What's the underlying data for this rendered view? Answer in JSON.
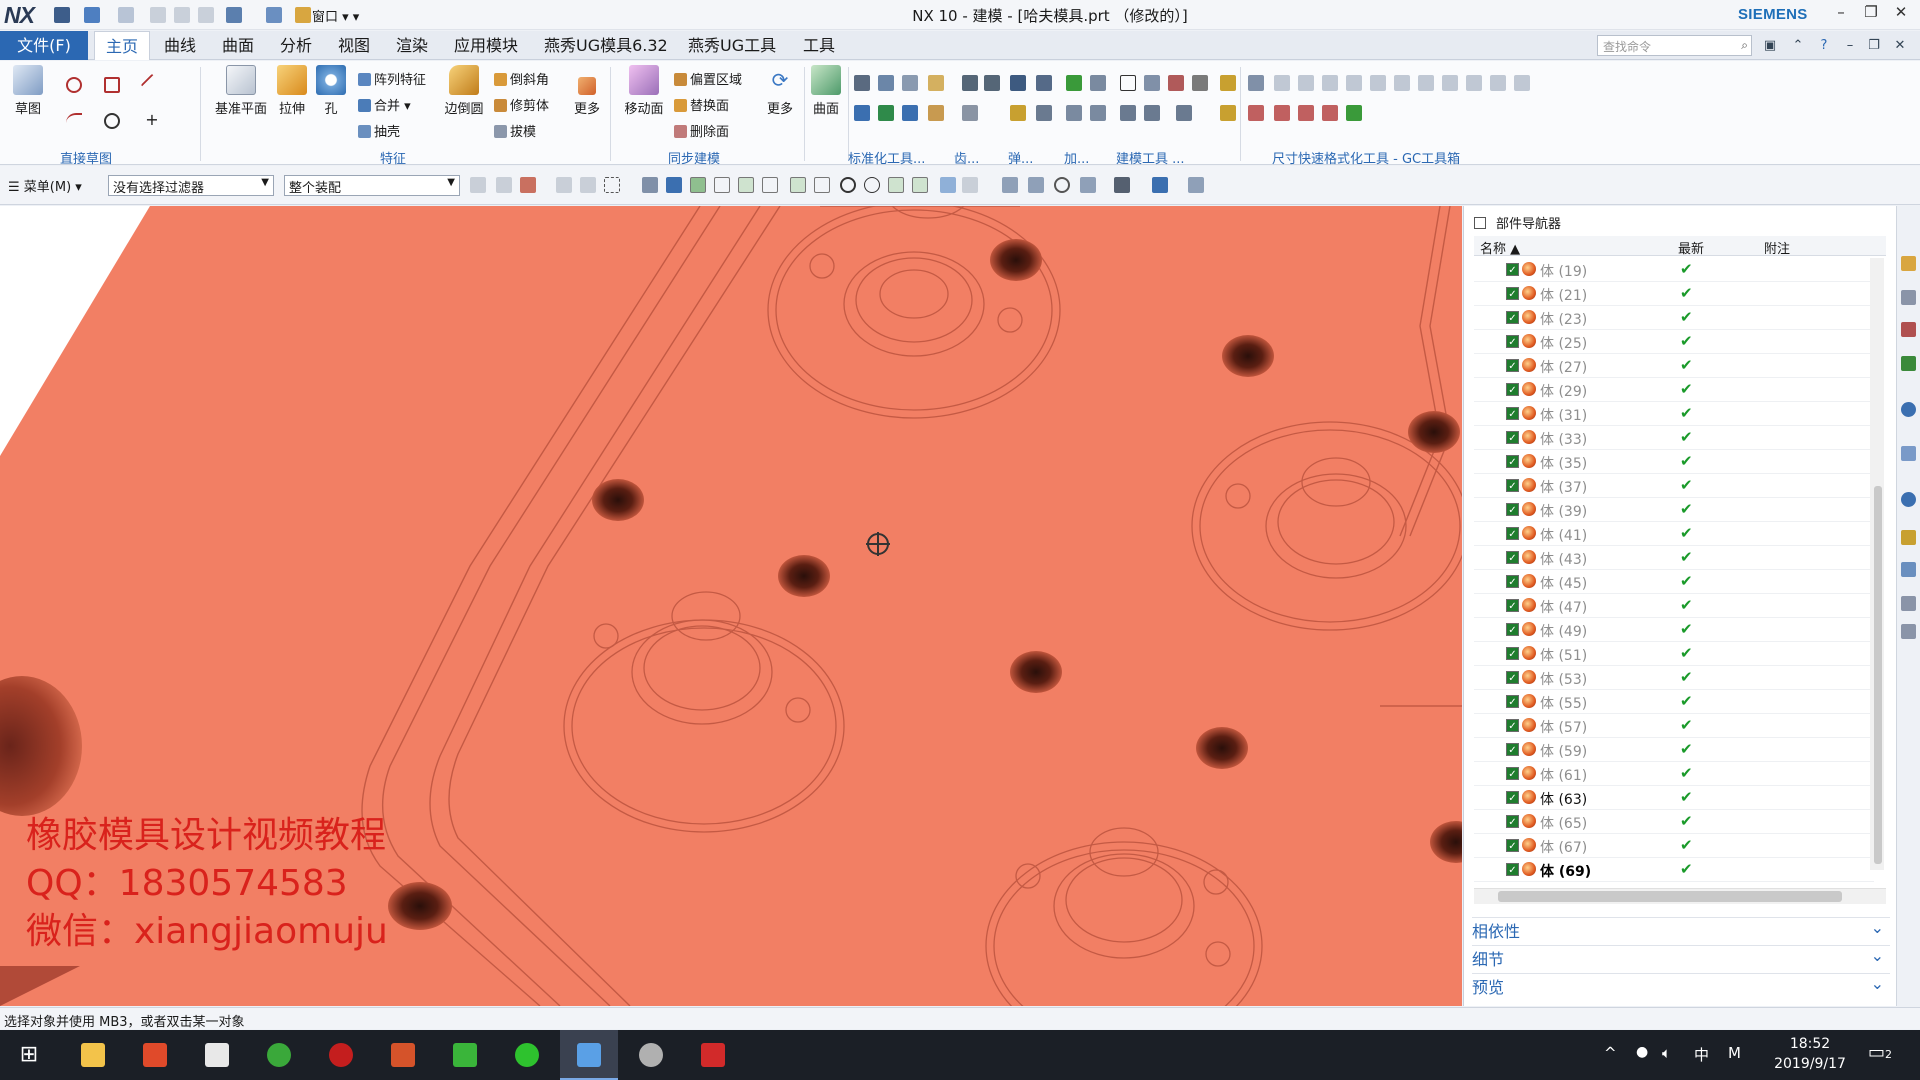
{
  "titlebar": {
    "logo": "NX",
    "window_menu": "窗口",
    "title": "NX 10 - 建模 - [哈夫模具.prt （修改的）]",
    "brand": "SIEMENS"
  },
  "tabs": {
    "file": "文件(F)",
    "items": [
      "主页",
      "曲线",
      "曲面",
      "分析",
      "视图",
      "渲染",
      "应用模块",
      "燕秀UG模具6.32",
      "燕秀UG工具",
      "工具"
    ],
    "active": "主页",
    "search_placeholder": "查找命令"
  },
  "ribbon": {
    "sketch_label": "草图",
    "direct_sketch": "直接草图",
    "datum_plane": "基准平面",
    "extrude": "拉伸",
    "hole": "孔",
    "pattern_feature": "阵列特征",
    "unite": "合并",
    "shell": "抽壳",
    "edge_blend": "边倒圆",
    "chamfer": "倒斜角",
    "trim_body": "修剪体",
    "draft": "拔模",
    "more_1": "更多",
    "feature": "特征",
    "move_face": "移动面",
    "offset_region": "偏置区域",
    "replace_face": "替换面",
    "delete_face": "删除面",
    "more_2": "更多",
    "sync_modeling": "同步建模",
    "surface": "曲面",
    "std_tools": "标准化工具...",
    "gear": "齿...",
    "spring": "弹...",
    "add": "加...",
    "modeling_tools": "建模工具 ...",
    "dim_tools": "尺寸快速格式化工具 - GC工具箱"
  },
  "selbar": {
    "menu": "菜单(M)",
    "filter": "没有选择过滤器",
    "scope": "整个装配"
  },
  "viewport": {
    "watermark_lines": [
      "橡胶模具设计视频教程",
      "QQ：1830574583",
      "微信：xiangjiaomuju"
    ],
    "part_color": "#f27f64"
  },
  "navigator": {
    "title": "部件导航器",
    "col_name": "名称",
    "col_latest": "最新",
    "col_note": "附注",
    "rows": [
      {
        "name": "体 (19)",
        "state": "dim"
      },
      {
        "name": "体 (21)",
        "state": "dim"
      },
      {
        "name": "体 (23)",
        "state": "dim"
      },
      {
        "name": "体 (25)",
        "state": "dim"
      },
      {
        "name": "体 (27)",
        "state": "dim"
      },
      {
        "name": "体 (29)",
        "state": "dim"
      },
      {
        "name": "体 (31)",
        "state": "dim"
      },
      {
        "name": "体 (33)",
        "state": "dim"
      },
      {
        "name": "体 (35)",
        "state": "dim"
      },
      {
        "name": "体 (37)",
        "state": "dim"
      },
      {
        "name": "体 (39)",
        "state": "dim"
      },
      {
        "name": "体 (41)",
        "state": "dim"
      },
      {
        "name": "体 (43)",
        "state": "dim"
      },
      {
        "name": "体 (45)",
        "state": "dim"
      },
      {
        "name": "体 (47)",
        "state": "dim"
      },
      {
        "name": "体 (49)",
        "state": "dim"
      },
      {
        "name": "体 (51)",
        "state": "dim"
      },
      {
        "name": "体 (53)",
        "state": "dim"
      },
      {
        "name": "体 (55)",
        "state": "dim"
      },
      {
        "name": "体 (57)",
        "state": "dim"
      },
      {
        "name": "体 (59)",
        "state": "dim"
      },
      {
        "name": "体 (61)",
        "state": "dim"
      },
      {
        "name": "体 (63)",
        "state": "cur"
      },
      {
        "name": "体 (65)",
        "state": "dim"
      },
      {
        "name": "体 (67)",
        "state": "dim"
      },
      {
        "name": "体 (69)",
        "state": "bold"
      }
    ],
    "latest_mark": "✔",
    "sections": [
      "相依性",
      "细节",
      "预览"
    ]
  },
  "status": {
    "text": "选择对象并使用 MB3，或者双击某一对象"
  },
  "taskbar": {
    "time": "18:52",
    "date": "2019/9/17",
    "ime": "中",
    "ime2": "M",
    "notify_count": "2"
  }
}
